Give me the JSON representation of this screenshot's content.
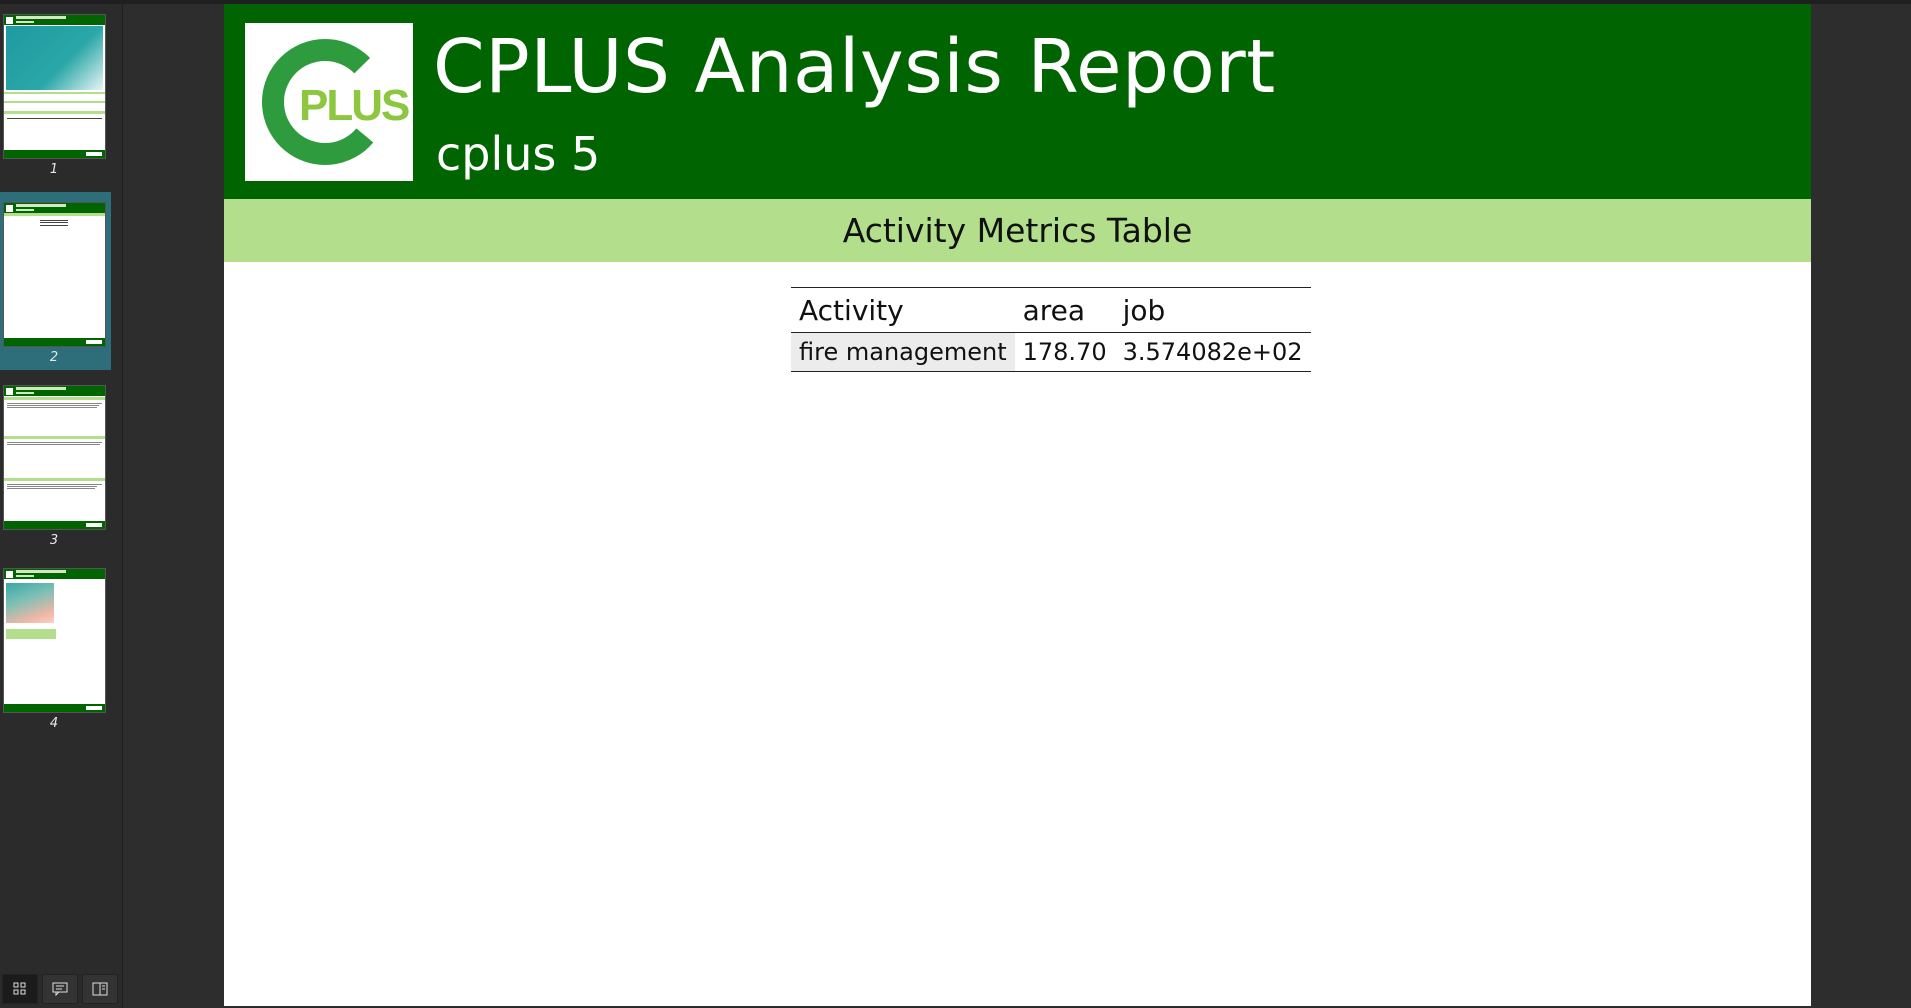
{
  "sidebar": {
    "pages": [
      {
        "number": "1"
      },
      {
        "number": "2"
      },
      {
        "number": "3"
      },
      {
        "number": "4"
      }
    ],
    "active_page": "2",
    "tools": [
      {
        "icon": "grid-icon"
      },
      {
        "icon": "comment-icon"
      },
      {
        "icon": "book-icon"
      }
    ]
  },
  "report": {
    "title": "CPLUS Analysis Report",
    "subtitle": "cplus 5",
    "logo_text": "PLUS",
    "section_title": "Activity Metrics Table",
    "table": {
      "headers": [
        "Activity",
        "area",
        "job"
      ],
      "rows": [
        [
          "fire management",
          "178.70",
          "3.574082e+02"
        ]
      ]
    }
  },
  "colors": {
    "header_green": "#006400",
    "band_green": "#b3df8d",
    "logo_light_green": "#8dc63f",
    "logo_dark_green": "#2e9b3e",
    "active_thumb": "#2e6d7a"
  }
}
